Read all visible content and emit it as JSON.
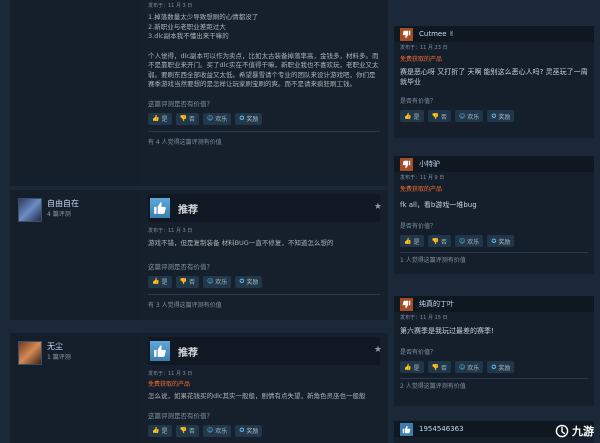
{
  "review0": {
    "posted": "发布于：11 月 3 日",
    "lines": [
      "1.掉落数量太少导致想刷的心情都没了",
      "2.新职业与老职业差距过大",
      "3.dlc副本我不懂出来干嘛的"
    ],
    "para": "个人觉得，dlc副本可以作为卖点，比如太古装备掉落率高，金钱多，材料多。而不是靠职业来开门。买了dlc实在不值得干嘛，新职业我也不喜欢玩，老职业又太弱。要刷东西全部收益又太低。希望暴雪请个专业的团队来设计游戏吧，你们是赛季游戏当然要想的是怎样让玩家刷宝刷的爽。而不是请来疯狂刷工钱。",
    "helpful_q": "这篇评测是否有价值？",
    "buttons": [
      "是",
      "否",
      "欢乐",
      "奖励"
    ],
    "count": "有 4 人觉得这篇评测有价值"
  },
  "review1": {
    "user": "自由自在",
    "user_count": "4 篇评测",
    "verdict": "推荐",
    "posted": "发布于：11 月 3 日",
    "text": "游戏不错，但是复制装备 材料BUG一直不修复，不知道怎么想的",
    "helpful_q": "这篇评测是否有价值？",
    "buttons": [
      "是",
      "否",
      "欢乐",
      "奖励"
    ],
    "count": "有 3 人觉得这篇评测有价值"
  },
  "review2": {
    "user": "无尘",
    "user_count": "1 篇评测",
    "verdict": "推荐",
    "posted": "发布于：11 月 3 日",
    "free_tag": "免费获取的产品",
    "text": "怎么说，如果花钱买的dlc其实一般般，剧情有点失望，新角色灵巫也一般般",
    "helpful_q": "这篇评测是否有价值？",
    "buttons": [
      "是",
      "否",
      "欢乐",
      "奖励"
    ]
  },
  "right0": {
    "name": "Cutmee ✌",
    "posted": "发布于：11 月 23 日",
    "free_tag": "免费获取的产品",
    "text": "赛是恶心呀 又打折了 天啊 能别这么恶心人吗? 灵巫玩了一周就毕业",
    "helpful_q": "是否有价值？",
    "buttons": [
      "是",
      "否",
      "欢乐",
      "奖励"
    ]
  },
  "right1": {
    "name": "小特驴",
    "posted": "发布于：11 月 9 日",
    "free_tag": "免费获取的产品",
    "text": "fk all，看b游戏一堆bug",
    "helpful_q": "是否有价值？",
    "buttons": [
      "是",
      "否",
      "欢乐",
      "奖励"
    ],
    "count": "1 人觉得这篇评测有价值"
  },
  "right2": {
    "name": "纯真的丁叶",
    "posted": "发布于：11 月 15 日",
    "text": "第六赛季是我玩过最差的赛季!",
    "helpful_q": "是否有价值？",
    "buttons": [
      "是",
      "否",
      "欢乐",
      "奖励"
    ],
    "count": "2 人觉得这篇评测有价值"
  },
  "right3": {
    "name": "1954546363"
  },
  "watermark": {
    "text": "九游"
  }
}
